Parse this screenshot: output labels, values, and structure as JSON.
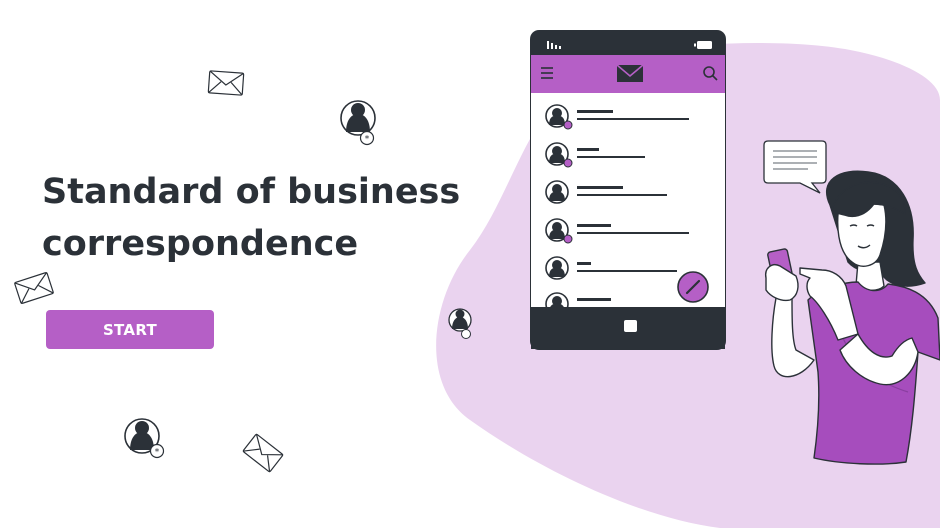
{
  "hero": {
    "title_line1": "Standard of business",
    "title_line2": "correspondence",
    "start_label": "START"
  },
  "colors": {
    "accent": "#b55fc6",
    "blob": "#ead3ef",
    "ink": "#2b3138",
    "shirt": "#a64dbd"
  },
  "phone": {
    "app_icon": "envelope-icon",
    "menu_icon": "menu-icon",
    "search_icon": "search-icon",
    "fab_icon": "pencil-icon",
    "contacts_count_visible": 6
  }
}
